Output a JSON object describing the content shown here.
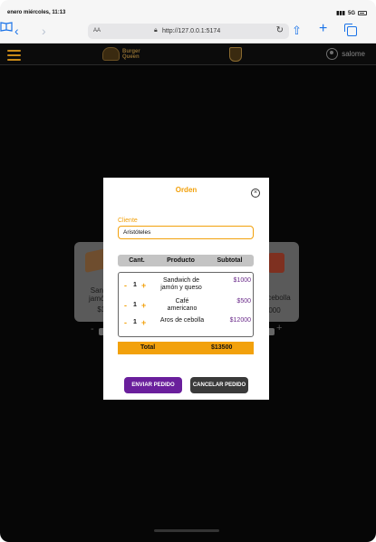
{
  "status_bar": {
    "time": "enero miércoles, 11:13",
    "network": "5G"
  },
  "browser": {
    "aa_label": "AA",
    "url": "http://127.0.0.1:5174"
  },
  "app": {
    "logo_line1": "Burger",
    "logo_line2": "Queen",
    "username": "salome",
    "background_cards": [
      {
        "name_line1": "Sandw",
        "name_line2": "jamón y",
        "price": "$10"
      },
      {
        "name_line1": "cebolla",
        "name_line2": "000"
      }
    ]
  },
  "modal": {
    "title": "Orden",
    "close_symbol": "×",
    "client_label": "Cliente",
    "client_value": "Aristóteles",
    "columns": [
      "Cant.",
      "Producto",
      "Subtotal"
    ],
    "items": [
      {
        "qty": "1",
        "name": "Sandwich de jamón y queso",
        "subtotal": "$1000"
      },
      {
        "qty": "1",
        "name": "Café americano",
        "subtotal": "$500"
      },
      {
        "qty": "1",
        "name": "Aros de cebolla",
        "subtotal": "$12000"
      }
    ],
    "minus_symbol": "-",
    "plus_symbol": "+",
    "total_label": "Total",
    "total_value": "$13500",
    "send_button": "ENVIAR PEDIDO",
    "cancel_button": "CANCELAR PEDIDO"
  },
  "colors": {
    "accent": "#f2a10c",
    "primary_button": "#6a1f9c",
    "secondary_button": "#3a3a3a",
    "subtotal_text": "#6a2a8a"
  }
}
